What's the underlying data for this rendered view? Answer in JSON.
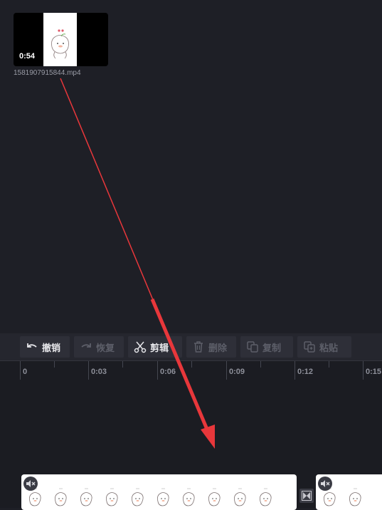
{
  "media": {
    "duration": "0:54",
    "filename": "1581907915844.mp4"
  },
  "toolbar": {
    "undo": "撤销",
    "redo": "恢复",
    "cut": "剪辑",
    "delete": "删除",
    "copy": "复制",
    "paste": "粘贴"
  },
  "ruler": {
    "labels": [
      "0",
      "0:03",
      "0:06",
      "0:09",
      "0:12",
      "0:15"
    ]
  },
  "icons": {
    "undo": "undo-icon",
    "redo": "redo-icon",
    "cut": "scissors-icon",
    "delete": "trash-icon",
    "copy": "copy-icon",
    "paste": "paste-icon",
    "mute": "speaker-muted-icon",
    "transition": "transition-icon"
  },
  "colors": {
    "background": "#1e1f26",
    "toolbar": "#25262e",
    "button": "#2e2f38",
    "enabled_text": "#e6e6ea",
    "disabled_text": "#5d5f69",
    "annotation_arrow": "#e8373b"
  }
}
